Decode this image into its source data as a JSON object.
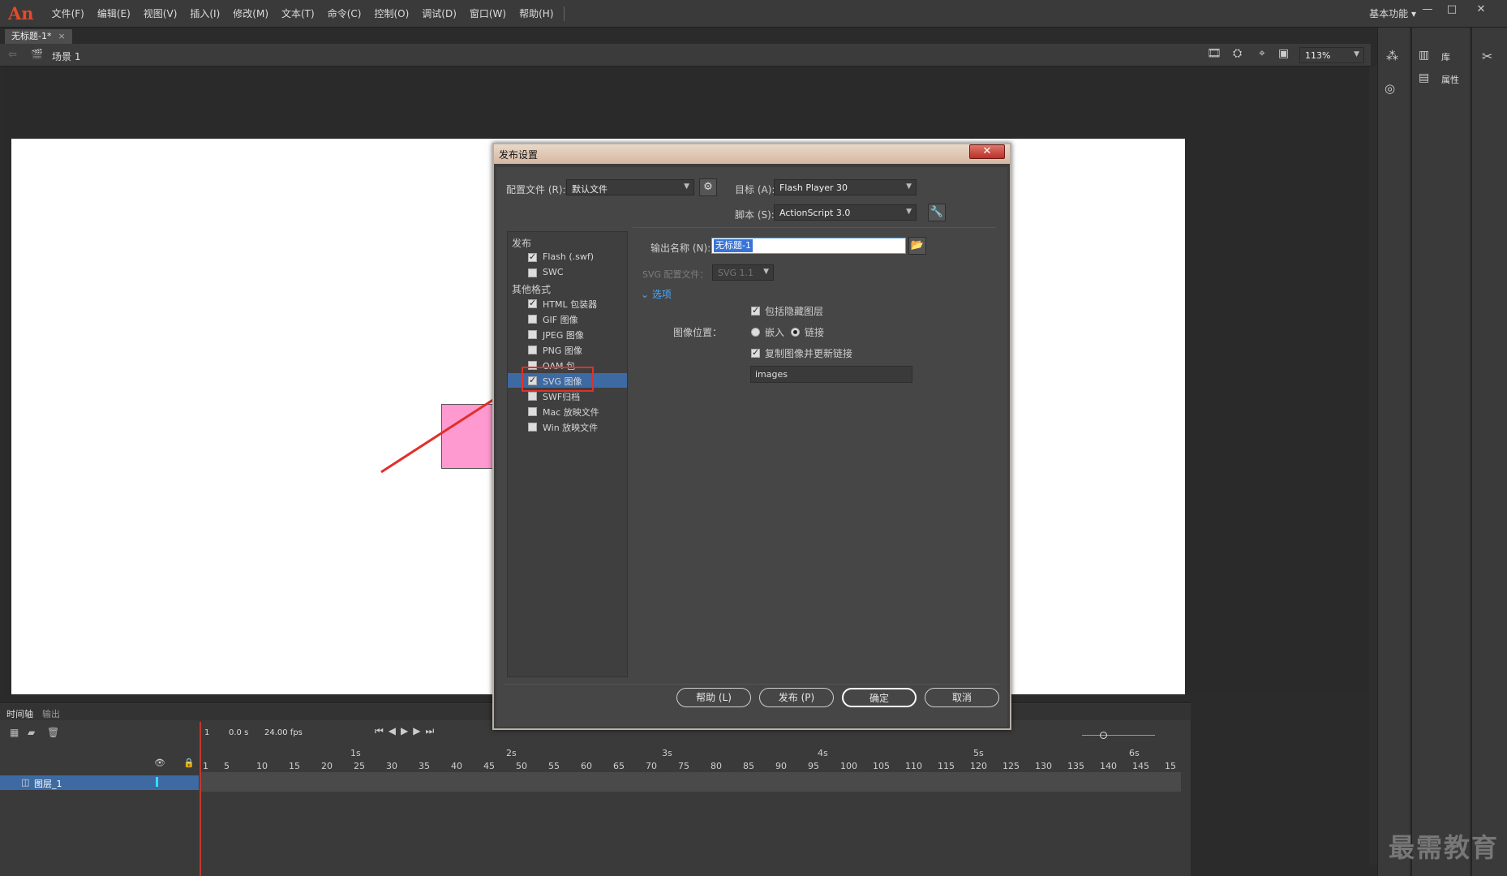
{
  "app": {
    "logo": "An"
  },
  "menu": [
    "文件(F)",
    "编辑(E)",
    "视图(V)",
    "插入(I)",
    "修改(M)",
    "文本(T)",
    "命令(C)",
    "控制(O)",
    "调试(D)",
    "窗口(W)",
    "帮助(H)"
  ],
  "workspace": "基本功能",
  "window_controls": {
    "min": "—",
    "max": "□",
    "close": "✕"
  },
  "doc_tab": {
    "title": "无标题-1*",
    "close": "×"
  },
  "editbar": {
    "scene": "场景 1",
    "zoom": "113%"
  },
  "right_panel": {
    "library": "库",
    "properties": "属性"
  },
  "dialog": {
    "title": "发布设置",
    "close": "✕",
    "profile_label": "配置文件 (R):",
    "profile_value": "默认文件",
    "target_label": "目标 (A):",
    "target_value": "Flash Player 30",
    "script_label": "脚本 (S):",
    "script_value": "ActionScript 3.0",
    "publish_header": "发布",
    "publish_items": [
      {
        "label": "Flash (.swf)",
        "checked": true
      },
      {
        "label": "SWC",
        "checked": false
      }
    ],
    "other_header": "其他格式",
    "other_items": [
      {
        "label": "HTML 包装器",
        "checked": true
      },
      {
        "label": "GIF 图像",
        "checked": false
      },
      {
        "label": "JPEG 图像",
        "checked": false
      },
      {
        "label": "PNG 图像",
        "checked": false
      },
      {
        "label": "OAM 包",
        "checked": false
      },
      {
        "label": "SVG 图像",
        "checked": true,
        "selected": true
      },
      {
        "label": "SWF归档",
        "checked": false
      },
      {
        "label": "Mac 放映文件",
        "checked": false
      },
      {
        "label": "Win 放映文件",
        "checked": false
      }
    ],
    "output_label": "输出名称 (N):",
    "output_value": "无标题-1",
    "svg_profile_label": "SVG 配置文件：",
    "svg_profile_value": "SVG 1.1",
    "options_label": "选项",
    "include_hidden": "包括隐藏图层",
    "image_location_label": "图像位置：",
    "embed_label": "嵌入",
    "link_label": "链接",
    "copy_images": "复制图像并更新链接",
    "images_folder": "images",
    "buttons": {
      "help": "帮助 (L)",
      "publish": "发布 (P)",
      "ok": "确定",
      "cancel": "取消"
    }
  },
  "timeline": {
    "tab_timeline": "时间轴",
    "tab_output": "输出",
    "frame": "1",
    "time": "0.0 s",
    "fps": "24.00 fps",
    "layer": "图层_1",
    "seconds": [
      "1s",
      "2s",
      "3s",
      "4s",
      "5s",
      "6s"
    ],
    "frame_ticks": [
      "1",
      "5",
      "10",
      "15",
      "20",
      "25",
      "30",
      "35",
      "40",
      "45",
      "50",
      "55",
      "60",
      "65",
      "70",
      "75",
      "80",
      "85",
      "90",
      "95",
      "100",
      "105",
      "110",
      "115",
      "120",
      "125",
      "130",
      "135",
      "140",
      "145",
      "15"
    ]
  },
  "watermark": "最需教育",
  "colors": {
    "accent_red": "#e0302a",
    "selection_blue": "#3d6aa3",
    "shape_pink": "#ff9ad1"
  }
}
